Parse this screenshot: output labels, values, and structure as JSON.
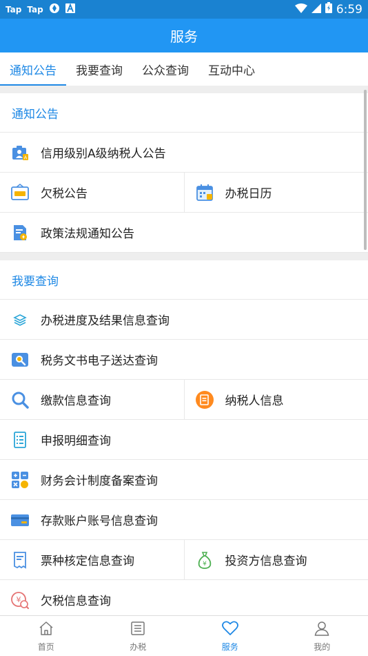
{
  "status_bar": {
    "left_apps": [
      "Tap",
      "Tap"
    ],
    "time": "6:59"
  },
  "header": {
    "title": "服务"
  },
  "tabs": [
    {
      "label": "通知公告",
      "active": true
    },
    {
      "label": "我要查询",
      "active": false
    },
    {
      "label": "公众查询",
      "active": false
    },
    {
      "label": "互动中心",
      "active": false
    }
  ],
  "sections": {
    "notice": {
      "title": "通知公告",
      "items": {
        "credit_a": "信用级别A级纳税人公告",
        "arrears": "欠税公告",
        "calendar": "办税日历",
        "policy": "政策法规通知公告"
      }
    },
    "query": {
      "title": "我要查询",
      "items": {
        "progress": "办税进度及结果信息查询",
        "documents": "税务文书电子送达查询",
        "payment": "缴款信息查询",
        "taxpayer": "纳税人信息",
        "declaration": "申报明细查询",
        "accounting": "财务会计制度备案查询",
        "bank": "存款账户账号信息查询",
        "invoice_type": "票种核定信息查询",
        "investor": "投资方信息查询",
        "arrears_query": "欠税信息查询"
      }
    }
  },
  "bottom_nav": [
    {
      "label": "首页",
      "icon": "home-icon",
      "active": false
    },
    {
      "label": "办税",
      "icon": "list-icon",
      "active": false
    },
    {
      "label": "服务",
      "icon": "heart-icon",
      "active": true
    },
    {
      "label": "我的",
      "icon": "user-icon",
      "active": false
    }
  ],
  "colors": {
    "status_bar": "#1a82d1",
    "header": "#2196f3",
    "accent": "#1e88e5",
    "taxpayer_icon": "#ff8a1f",
    "investor_icon": "#4caf50"
  }
}
